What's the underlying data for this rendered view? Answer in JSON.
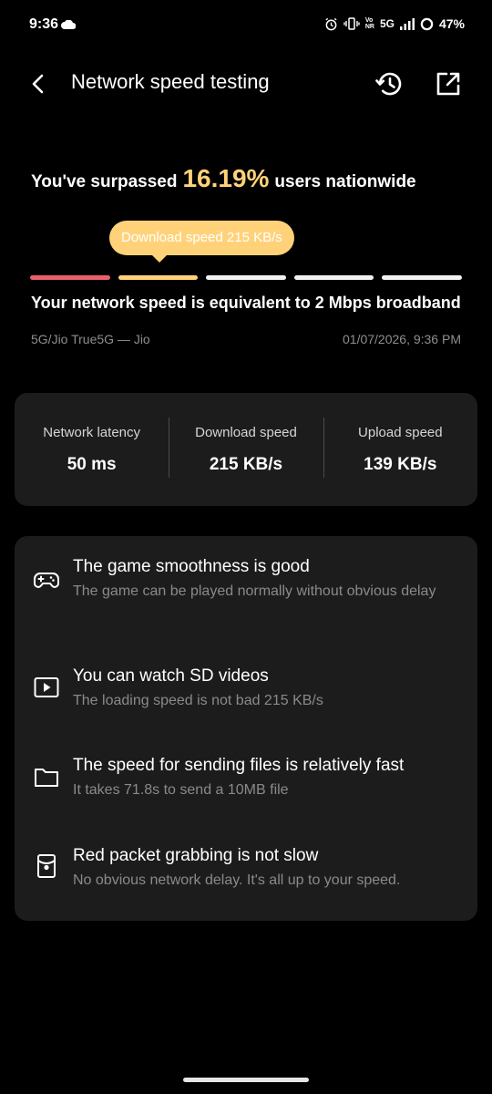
{
  "status_bar": {
    "time": "9:36",
    "network_top": "Vo",
    "network_bottom": "NR",
    "network_type": "5G",
    "battery": "47%"
  },
  "header": {
    "title": "Network speed testing"
  },
  "summary": {
    "prefix": "You've surpassed",
    "percentage": "16.19%",
    "suffix": "users nationwide",
    "tooltip": "Download speed 215 KB/s",
    "equivalent": "Your network speed is equivalent to 2 Mbps broadband",
    "network_name": "5G/Jio True5G — Jio",
    "test_time": "01/07/2026, 9:36 PM",
    "level_bars": {
      "count": 5,
      "active_index": 1,
      "colors": [
        "#e8606a",
        "#ffd27a",
        "#f2f2f2",
        "#f2f2f2",
        "#f2f2f2"
      ]
    }
  },
  "stats": [
    {
      "label": "Network latency",
      "value": "50 ms"
    },
    {
      "label": "Download speed",
      "value": "215 KB/s"
    },
    {
      "label": "Upload speed",
      "value": "139 KB/s"
    }
  ],
  "experiences": [
    {
      "icon": "gamepad-icon",
      "title": "The game smoothness is good",
      "desc": "The game can be played normally without obvious delay"
    },
    {
      "icon": "video-play-icon",
      "title": "You can watch SD videos",
      "desc": "The loading speed is not bad 215 KB/s"
    },
    {
      "icon": "folder-icon",
      "title": "The speed for sending files is relatively fast",
      "desc": "It takes 71.8s to send a 10MB file"
    },
    {
      "icon": "red-packet-icon",
      "title": "Red packet grabbing is not slow",
      "desc": "No obvious network delay. It's all up to your speed."
    }
  ],
  "colors": {
    "background": "#000000",
    "card": "#1c1c1c",
    "accent": "#ffd27a",
    "low_level": "#e8606a",
    "muted_text": "#8a8a8a"
  }
}
